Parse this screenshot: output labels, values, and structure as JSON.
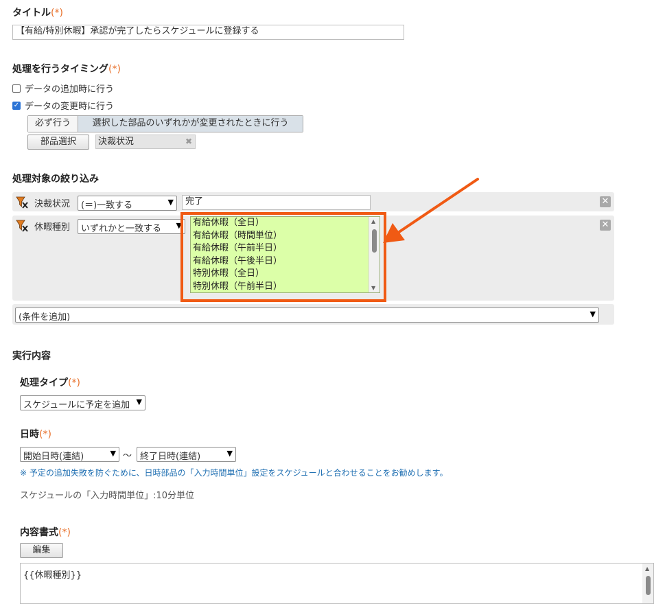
{
  "title_section": {
    "label": "タイトル",
    "required_mark": "(*)",
    "value": "【有給/特別休暇】承認が完了したらスケジュールに登録する"
  },
  "timing_section": {
    "label": "処理を行うタイミング",
    "required_mark": "(*)",
    "on_add": {
      "label": "データの追加時に行う",
      "checked": false
    },
    "on_change": {
      "label": "データの変更時に行う",
      "checked": true
    },
    "segment_always": "必ず行う",
    "segment_selected": "選択した部品のいずれかが変更されたときに行う",
    "field_select_button": "部品選択",
    "selected_field_tag": "決裁状況"
  },
  "filter_section": {
    "label": "処理対象の絞り込み",
    "conditions": [
      {
        "field": "決裁状況",
        "operator": "(＝)一致する",
        "value": "完了"
      },
      {
        "field": "休暇種別",
        "operator": "いずれかと一致する",
        "options": [
          "有給休暇（全日）",
          "有給休暇（時間単位）",
          "有給休暇（午前半日）",
          "有給休暇（午後半日）",
          "特別休暇（全日）",
          "特別休暇（午前半日）"
        ]
      }
    ],
    "add_condition": "(条件を追加)"
  },
  "execution_section": {
    "label": "実行内容",
    "process_type": {
      "label": "処理タイプ",
      "required_mark": "(*)",
      "value": "スケジュールに予定を追加"
    },
    "datetime": {
      "label": "日時",
      "required_mark": "(*)",
      "start": "開始日時(連結)",
      "separator": "〜",
      "end": "終了日時(連結)",
      "note": "※ 予定の追加失敗を防ぐために、日時部品の「入力時間単位」設定をスケジュールと合わせることをお勧めします。",
      "unit_info": "スケジュールの「入力時間単位」:10分単位"
    },
    "content_format": {
      "label": "内容書式",
      "required_mark": "(*)",
      "edit_button": "編集",
      "text": "{{休暇種別}}"
    }
  },
  "annotation": {
    "highlight_color": "#f05a14"
  }
}
